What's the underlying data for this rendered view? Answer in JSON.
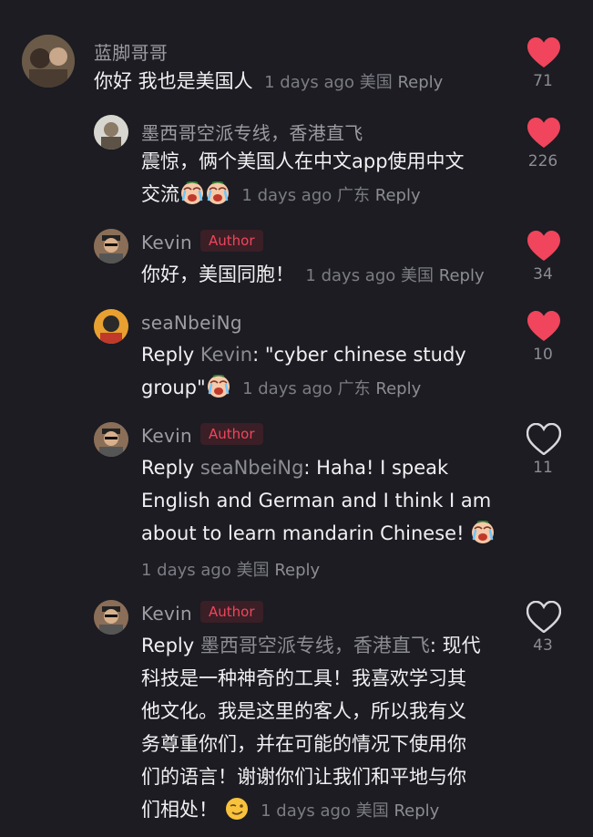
{
  "comments": [
    {
      "username": "蓝脚哥哥",
      "author_badge": "",
      "text": "你好 我也是美国人",
      "meta_time": "1 days ago",
      "meta_region": "美国",
      "reply_label": "Reply",
      "likes": "71",
      "liked": true
    },
    {
      "username": "墨西哥空派专线，香港直飞",
      "author_badge": "",
      "text_line1": "震惊，俩个美国人在中文app使用中文",
      "text_line2": "交流",
      "emoji": [
        "crying-face",
        "crying-face"
      ],
      "meta_time": "1 days ago",
      "meta_region": "广东",
      "reply_label": "Reply",
      "likes": "226",
      "liked": true
    },
    {
      "username": "Kevin",
      "author_badge": "Author",
      "text": "你好，美国同胞！",
      "meta_time": "1 days ago",
      "meta_region": "美国",
      "reply_label": "Reply",
      "likes": "34",
      "liked": true
    },
    {
      "username": "seaNbeiNg",
      "author_badge": "",
      "reply_prefix": "Reply",
      "reply_to": "Kevin",
      "text_line1": ": \"cyber chinese study",
      "text_line2": "group\"",
      "emoji": [
        "crying-face"
      ],
      "meta_time": "1 days ago",
      "meta_region": "广东",
      "reply_label": "Reply",
      "likes": "10",
      "liked": true
    },
    {
      "username": "Kevin",
      "author_badge": "Author",
      "reply_prefix": "Reply",
      "reply_to": "seaNbeiNg",
      "text_line1": ": Haha! I speak",
      "text_line2": "English and German and I think I am",
      "text_line3": "about to learn mandarin Chinese!",
      "emoji": [
        "crying-face"
      ],
      "meta_time": "1 days ago",
      "meta_region": "美国",
      "reply_label": "Reply",
      "likes": "11",
      "liked": false
    },
    {
      "username": "Kevin",
      "author_badge": "Author",
      "reply_prefix": "Reply",
      "reply_to": "墨西哥空派专线，香港直飞",
      "text_line1": ": 现代",
      "text_line2": "科技是一种神奇的工具！我喜欢学习其",
      "text_line3": "他文化。我是这里的客人，所以我有义",
      "text_line4": "务尊重你们，并在可能的情况下使用你",
      "text_line5": "们的语言！谢谢你们让我们和平地与你",
      "text_line6": "们相处！",
      "emoji": [
        "winking-face"
      ],
      "meta_time": "1 days ago",
      "meta_region": "美国",
      "reply_label": "Reply",
      "likes": "43",
      "liked": false
    }
  ],
  "colors": {
    "background": "#1c1c22",
    "like_active": "#f0455c",
    "author_badge": "#f0455c"
  }
}
